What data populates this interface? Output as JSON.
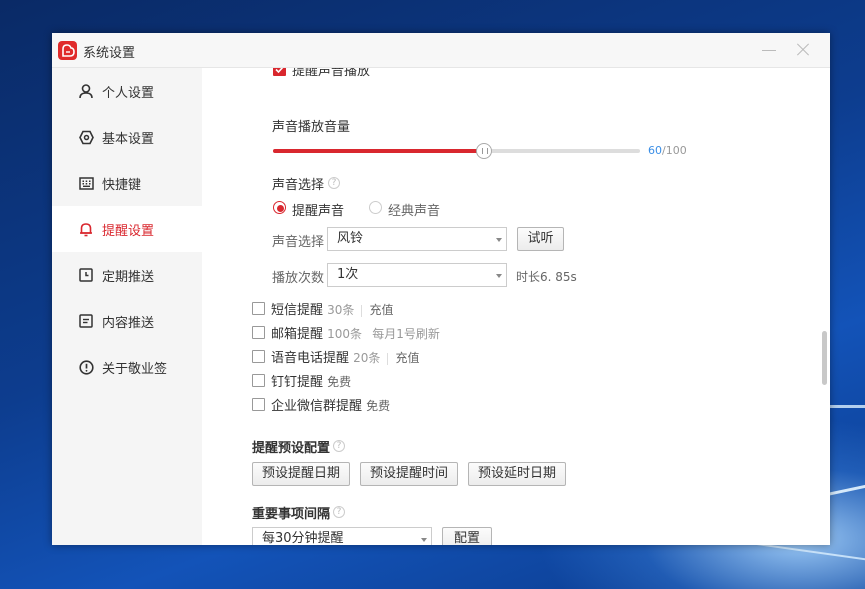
{
  "window": {
    "title": "系统设置"
  },
  "sidebar": {
    "items": [
      {
        "label": "个人设置",
        "icon": "user-icon"
      },
      {
        "label": "基本设置",
        "icon": "settings-icon"
      },
      {
        "label": "快捷键",
        "icon": "keyboard-icon"
      },
      {
        "label": "提醒设置",
        "icon": "bell-icon",
        "active": true
      },
      {
        "label": "定期推送",
        "icon": "clock-icon"
      },
      {
        "label": "内容推送",
        "icon": "document-icon"
      },
      {
        "label": "关于敬业签",
        "icon": "info-icon"
      }
    ]
  },
  "reminder": {
    "top_checkbox_label": "提醒声音播放",
    "volume_label": "声音播放音量",
    "volume_value": "60",
    "volume_max": "/100",
    "volume_fraction": 0.6,
    "sound_choice_label": "声音选择",
    "radio_reminder": "提醒声音",
    "radio_classic": "经典声音",
    "sound_select_label": "声音选择",
    "sound_select_value": "风铃",
    "listen_button": "试听",
    "play_count_label": "播放次数",
    "play_count_value": "1次",
    "duration_text": "时长6. 85s",
    "channels": [
      {
        "name": "短信提醒",
        "quota": "30条",
        "action": "充值",
        "has_sep": true
      },
      {
        "name": "邮箱提醒",
        "quota": "100条",
        "action": "每月1号刷新",
        "has_sep": false
      },
      {
        "name": "语音电话提醒",
        "quota": "20条",
        "action": "充值",
        "has_sep": true
      },
      {
        "name": "钉钉提醒",
        "quota": "免费",
        "action": "",
        "has_sep": false
      },
      {
        "name": "企业微信群提醒",
        "quota": "免费",
        "action": "",
        "has_sep": false
      }
    ],
    "preset_title": "提醒预设配置",
    "preset_buttons": [
      "预设提醒日期",
      "预设提醒时间",
      "预设延时日期"
    ],
    "important_title": "重要事项间隔",
    "important_select_value": "每30分钟提醒",
    "config_button": "配置"
  },
  "colors": {
    "accent": "#d9272e",
    "link": "#3a8ee6"
  }
}
